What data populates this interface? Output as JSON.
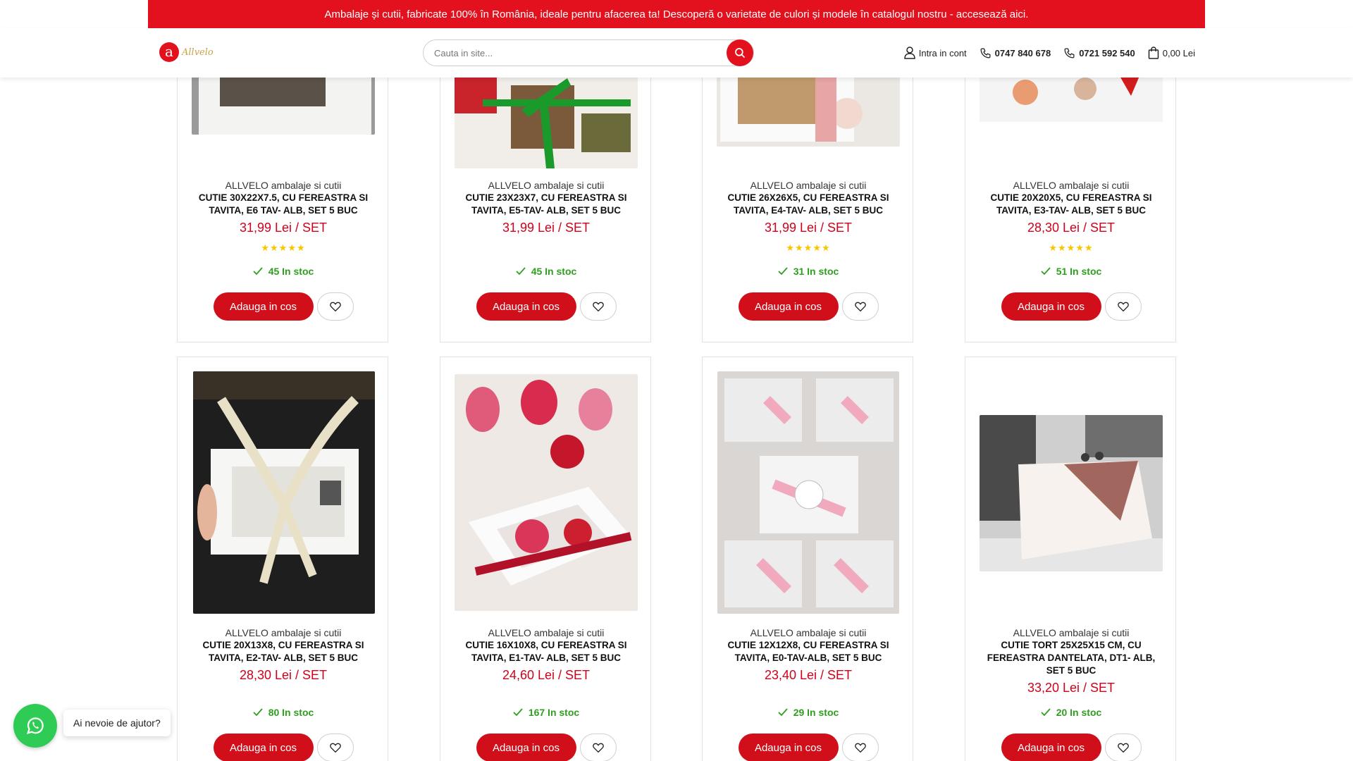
{
  "announcement": "Ambalaje și cutii, fabricate 100% în România, ideale pentru afacerea ta! Descoperă o varietate de culori și modele în catalogul nostru - accesează aici.",
  "logo": {
    "mark": "a",
    "text": "Allvelo"
  },
  "search": {
    "placeholder": "Cauta in site..."
  },
  "header": {
    "account": "Intra in cont",
    "phone1": "0747 840 678",
    "phone2": "0721 592 540",
    "cart": "0,00 Lei"
  },
  "colors": {
    "accent": "#e3111d",
    "price": "#d0021b",
    "stock": "#2f9e1f",
    "stars": "#f7c600",
    "whatsapp": "#2ecc55"
  },
  "products": [
    {
      "brand": "ALLVELO ambalaje si cutii",
      "title": "CUTIE 30X22X7.5, CU FEREASTRA SI TAVITA, E6 TAV- ALB, SET 5 BUC",
      "price": "31,99 Lei / SET",
      "stars": "★★★★★",
      "rating": 5,
      "stock": "45 In stoc",
      "add": "Adauga in cos"
    },
    {
      "brand": "ALLVELO ambalaje si cutii",
      "title": "CUTIE 23X23X7, CU FEREASTRA SI TAVITA, E5-TAV- ALB, SET 5 BUC",
      "price": "31,99 Lei / SET",
      "stars": "",
      "rating": 0,
      "stock": "45 In stoc",
      "add": "Adauga in cos"
    },
    {
      "brand": "ALLVELO ambalaje si cutii",
      "title": "CUTIE 26X26X5, CU FEREASTRA SI TAVITA, E4-TAV- ALB, SET 5 BUC",
      "price": "31,99 Lei / SET",
      "stars": "★★★★★",
      "rating": 5,
      "stock": "31 In stoc",
      "add": "Adauga in cos"
    },
    {
      "brand": "ALLVELO ambalaje si cutii",
      "title": "CUTIE 20X20X5, CU FEREASTRA SI TAVITA, E3-TAV- ALB, SET 5 BUC",
      "price": "28,30 Lei / SET",
      "stars": "★★★★★",
      "rating": 5,
      "stock": "51 In stoc",
      "add": "Adauga in cos"
    },
    {
      "brand": "ALLVELO ambalaje si cutii",
      "title": "CUTIE 20X13X8, CU FEREASTRA SI TAVITA, E2-TAV- ALB, SET 5 BUC",
      "price": "28,30 Lei / SET",
      "stars": "",
      "rating": 0,
      "stock": "80 In stoc",
      "add": "Adauga in cos"
    },
    {
      "brand": "ALLVELO ambalaje si cutii",
      "title": "CUTIE 16X10X8, CU FEREASTRA SI TAVITA, E1-TAV- ALB, SET 5 BUC",
      "price": "24,60 Lei / SET",
      "stars": "",
      "rating": 0,
      "stock": "167 In stoc",
      "add": "Adauga in cos"
    },
    {
      "brand": "ALLVELO ambalaje si cutii",
      "title": "CUTIE 12X12X8, CU FEREASTRA SI TAVITA, E0-TAV-ALB, SET 5 BUC",
      "price": "23,40 Lei / SET",
      "stars": "",
      "rating": 0,
      "stock": "29 In stoc",
      "add": "Adauga in cos"
    },
    {
      "brand": "ALLVELO ambalaje si cutii",
      "title": "CUTIE TORT 25X25X15 CM, CU FEREASTRA DANTELATA, DT1- ALB, SET 5 BUC",
      "price": "33,20 Lei / SET",
      "stars": "",
      "rating": 0,
      "stock": "20 In stoc",
      "add": "Adauga in cos"
    }
  ],
  "whatsapp": {
    "bubble": "Ai nevoie de ajutor?",
    "icon": "whatsapp-icon"
  }
}
